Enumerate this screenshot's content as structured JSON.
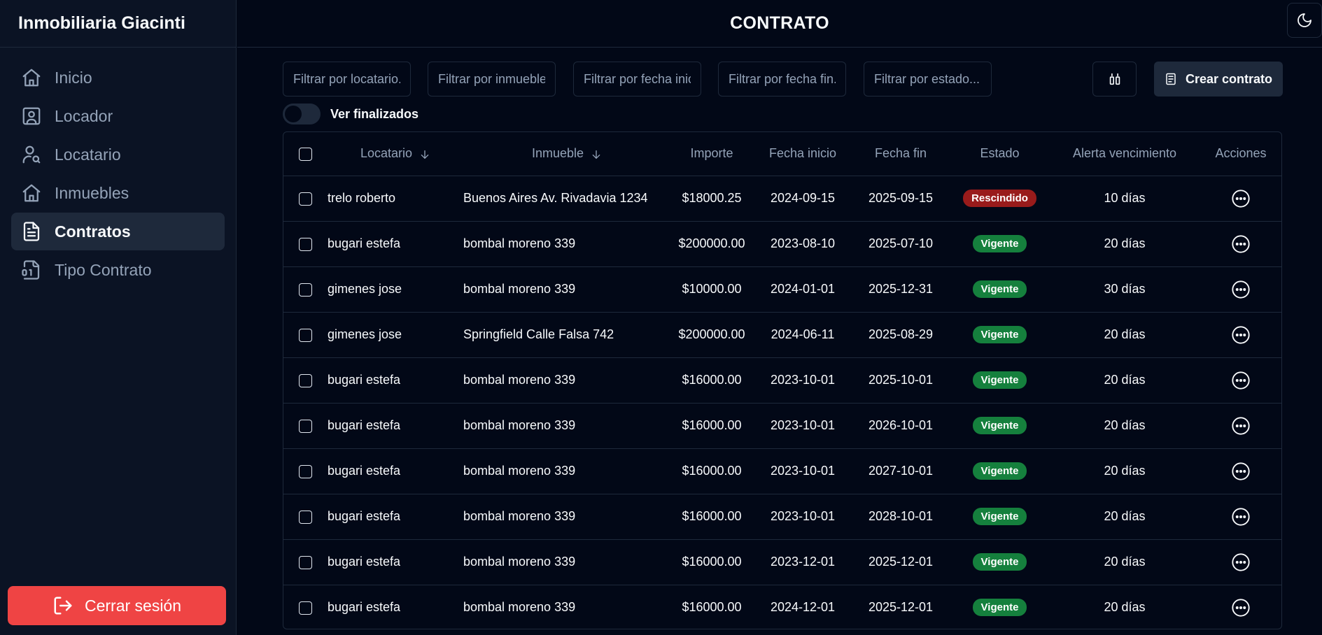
{
  "sidebar": {
    "brand": "Inmobiliaria Giacinti",
    "items": [
      {
        "label": "Inicio",
        "icon": "home-icon"
      },
      {
        "label": "Locador",
        "icon": "user-square-icon"
      },
      {
        "label": "Locatario",
        "icon": "user-search-icon"
      },
      {
        "label": "Inmuebles",
        "icon": "home-icon"
      },
      {
        "label": "Contratos",
        "icon": "file-text-icon"
      },
      {
        "label": "Tipo Contrato",
        "icon": "file-binary-icon"
      }
    ],
    "active_index": 4,
    "logout_label": "Cerrar sesión"
  },
  "header": {
    "title": "CONTRATO",
    "theme_icon": "moon-icon"
  },
  "filters": {
    "locatario_placeholder": "Filtrar por locatario...",
    "inmueble_placeholder": "Filtrar por inmueble...",
    "fecha_inicio_placeholder": "Filtrar por fecha inicio...",
    "fecha_fin_placeholder": "Filtrar por fecha fin...",
    "estado_placeholder": "Filtrar por estado...",
    "columns_icon": "columns-icon",
    "create_label": "Crear contrato",
    "toggle_label": "Ver finalizados",
    "toggle_on": false
  },
  "table": {
    "headers": {
      "locatario": "Locatario",
      "inmueble": "Inmueble",
      "importe": "Importe",
      "fecha_inicio": "Fecha inicio",
      "fecha_fin": "Fecha fin",
      "estado": "Estado",
      "alerta": "Alerta vencimiento",
      "acciones": "Acciones"
    },
    "rows": [
      {
        "locatario": "trelo roberto",
        "inmueble": "Buenos Aires Av. Rivadavia 1234",
        "importe": "$18000.25",
        "fecha_inicio": "2024-09-15",
        "fecha_fin": "2025-09-15",
        "estado": "Rescindido",
        "alerta": "10 días"
      },
      {
        "locatario": "bugari estefa",
        "inmueble": "bombal moreno 339",
        "importe": "$200000.00",
        "fecha_inicio": "2023-08-10",
        "fecha_fin": "2025-07-10",
        "estado": "Vigente",
        "alerta": "20 días"
      },
      {
        "locatario": "gimenes jose",
        "inmueble": "bombal moreno 339",
        "importe": "$10000.00",
        "fecha_inicio": "2024-01-01",
        "fecha_fin": "2025-12-31",
        "estado": "Vigente",
        "alerta": "30 días"
      },
      {
        "locatario": "gimenes jose",
        "inmueble": "Springfield Calle Falsa 742",
        "importe": "$200000.00",
        "fecha_inicio": "2024-06-11",
        "fecha_fin": "2025-08-29",
        "estado": "Vigente",
        "alerta": "20 días"
      },
      {
        "locatario": "bugari estefa",
        "inmueble": "bombal moreno 339",
        "importe": "$16000.00",
        "fecha_inicio": "2023-10-01",
        "fecha_fin": "2025-10-01",
        "estado": "Vigente",
        "alerta": "20 días"
      },
      {
        "locatario": "bugari estefa",
        "inmueble": "bombal moreno 339",
        "importe": "$16000.00",
        "fecha_inicio": "2023-10-01",
        "fecha_fin": "2026-10-01",
        "estado": "Vigente",
        "alerta": "20 días"
      },
      {
        "locatario": "bugari estefa",
        "inmueble": "bombal moreno 339",
        "importe": "$16000.00",
        "fecha_inicio": "2023-10-01",
        "fecha_fin": "2027-10-01",
        "estado": "Vigente",
        "alerta": "20 días"
      },
      {
        "locatario": "bugari estefa",
        "inmueble": "bombal moreno 339",
        "importe": "$16000.00",
        "fecha_inicio": "2023-10-01",
        "fecha_fin": "2028-10-01",
        "estado": "Vigente",
        "alerta": "20 días"
      },
      {
        "locatario": "bugari estefa",
        "inmueble": "bombal moreno 339",
        "importe": "$16000.00",
        "fecha_inicio": "2023-12-01",
        "fecha_fin": "2025-12-01",
        "estado": "Vigente",
        "alerta": "20 días"
      },
      {
        "locatario": "bugari estefa",
        "inmueble": "bombal moreno 339",
        "importe": "$16000.00",
        "fecha_inicio": "2024-12-01",
        "fecha_fin": "2025-12-01",
        "estado": "Vigente",
        "alerta": "20 días"
      }
    ]
  },
  "colors": {
    "background": "#020817",
    "sidebar": "#0b1324",
    "border": "#1e293b",
    "danger": "#ef4444",
    "badge_vigente": "#15803d",
    "badge_rescindido": "#991b1b"
  }
}
